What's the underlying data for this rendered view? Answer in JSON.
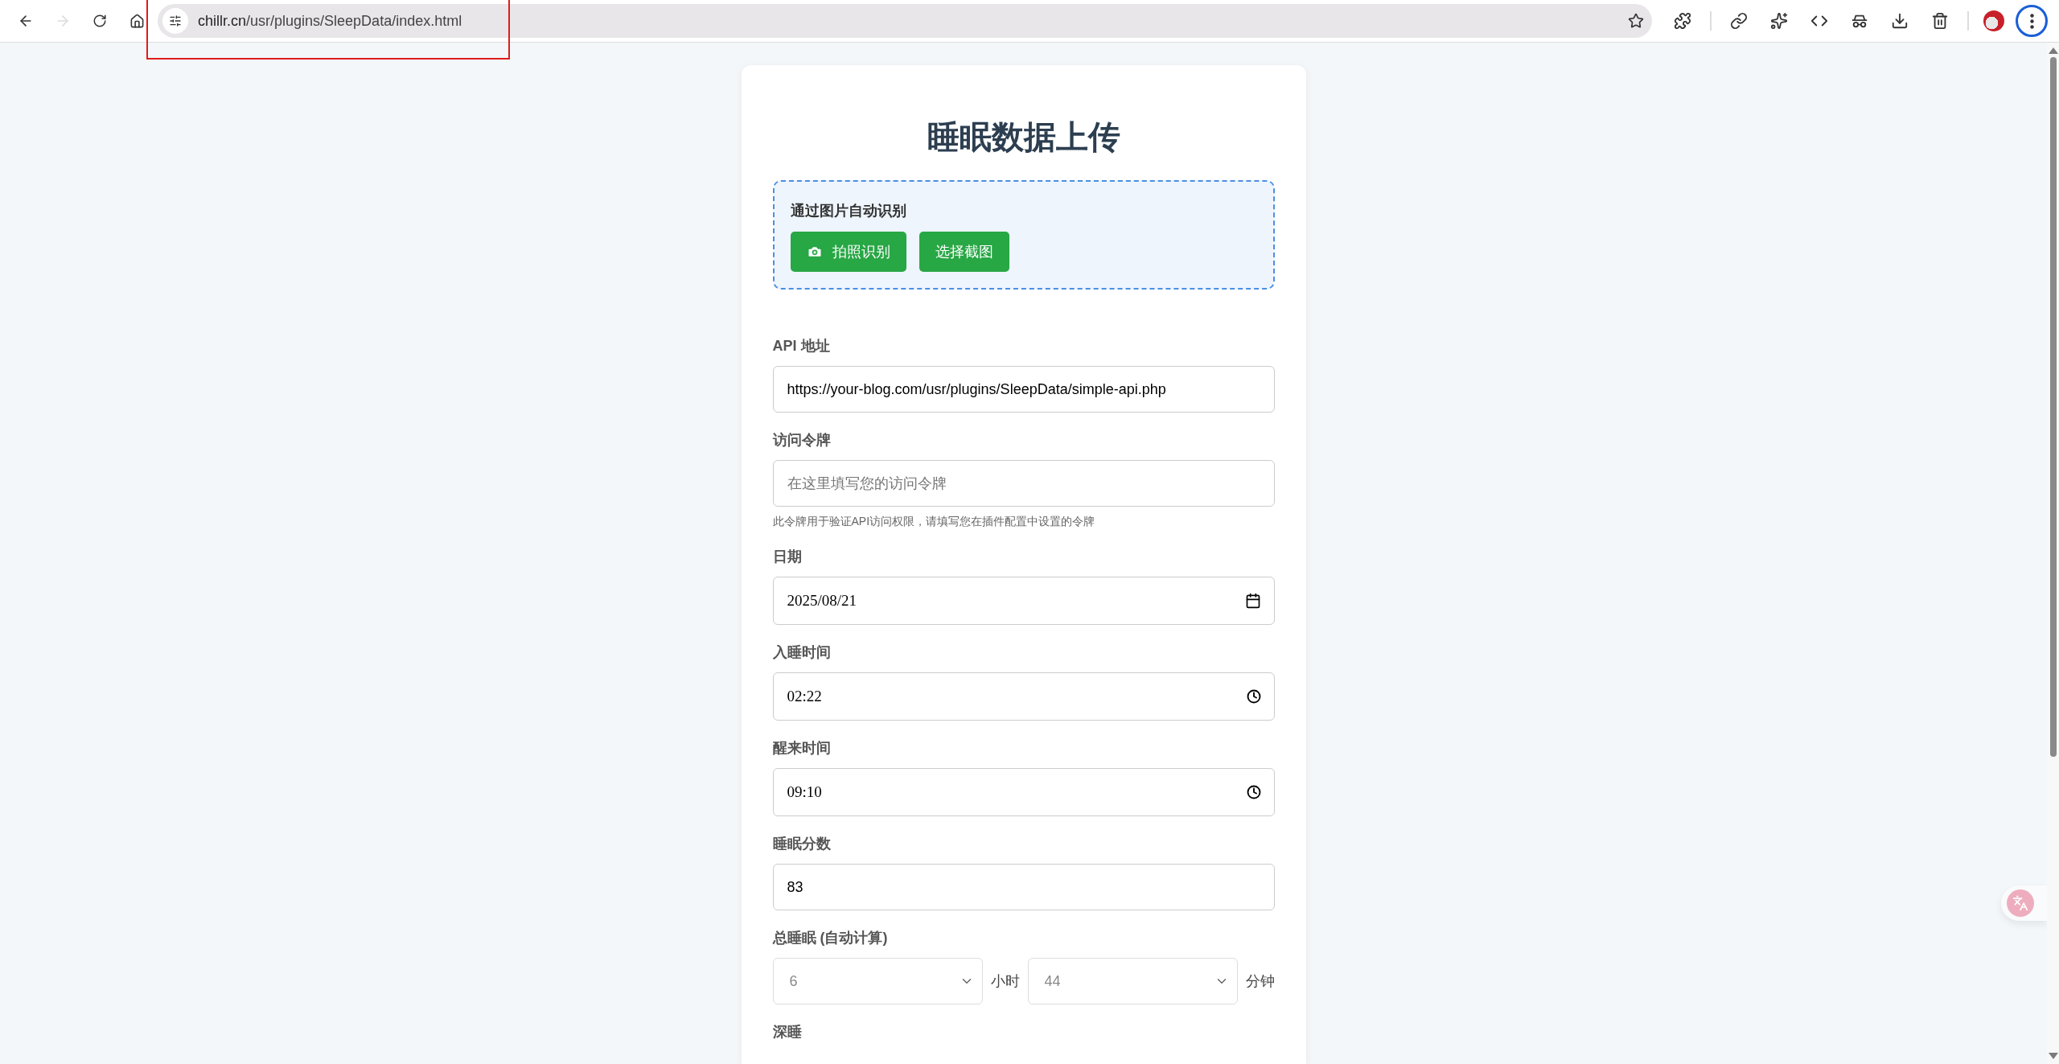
{
  "browser": {
    "nav": [
      {
        "kind": "back",
        "disabled": false
      },
      {
        "kind": "forward",
        "disabled": true
      },
      {
        "kind": "reload",
        "disabled": false
      },
      {
        "kind": "home",
        "disabled": false
      }
    ],
    "url_host": "chillr.cn",
    "url_path": "/usr/plugins/SleepData/index.html",
    "tools": [
      {
        "kind": "extensions"
      },
      {
        "kind": "divider"
      },
      {
        "kind": "link"
      },
      {
        "kind": "stars"
      },
      {
        "kind": "code"
      },
      {
        "kind": "incognito"
      },
      {
        "kind": "download"
      },
      {
        "kind": "trash"
      },
      {
        "kind": "divider"
      },
      {
        "kind": "avatar"
      },
      {
        "kind": "menu",
        "focused": true
      }
    ]
  },
  "form": {
    "title": "睡眠数据上传",
    "recognize": {
      "heading": "通过图片自动识别",
      "buttons": [
        {
          "label": "拍照识别",
          "kind": "camera"
        },
        {
          "label": "选择截图",
          "kind": "plain"
        }
      ]
    },
    "fields": [
      {
        "kind": "text",
        "label": "API 地址",
        "value": "https://your-blog.com/usr/plugins/SleepData/simple-api.php"
      },
      {
        "kind": "text",
        "label": "访问令牌",
        "placeholder": "在这里填写您的访问令牌",
        "hint": "此令牌用于验证API访问权限，请填写您在插件配置中设置的令牌"
      },
      {
        "kind": "date",
        "label": "日期",
        "value": "2025/08/21"
      },
      {
        "kind": "time",
        "label": "入睡时间",
        "value": "02:22"
      },
      {
        "kind": "time",
        "label": "醒来时间",
        "value": "09:10"
      },
      {
        "kind": "text",
        "label": "睡眠分数",
        "value": "83"
      },
      {
        "kind": "duration",
        "label": "总睡眠 (自动计算)",
        "disabled": true,
        "parts": [
          {
            "value": "6",
            "unit": "小时"
          },
          {
            "value": "44",
            "unit": "分钟"
          }
        ]
      },
      {
        "kind": "cut",
        "label": "深睡"
      }
    ]
  }
}
